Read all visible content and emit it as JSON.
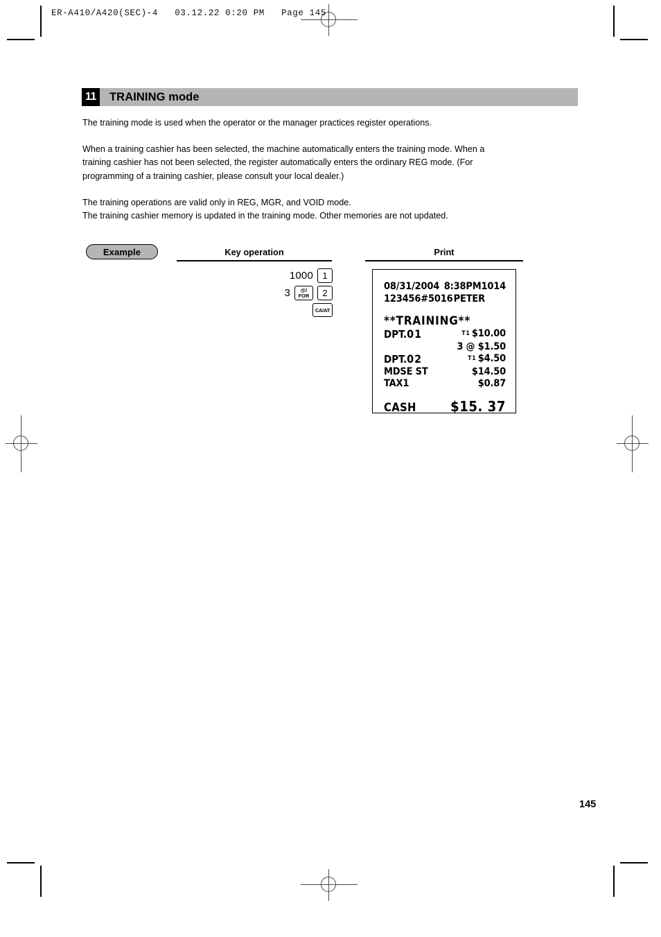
{
  "print_strip": {
    "text": "ER-A410/A420(SEC)-4   03.12.22 0:20 PM   Page 145"
  },
  "section": {
    "number": "11",
    "title": "TRAINING mode"
  },
  "paragraphs": [
    {
      "lines": [
        "The training mode is used when the operator or the manager practices register operations."
      ]
    },
    {
      "lines": [
        "When a training cashier has been selected, the machine automatically enters the training mode.  When a",
        "training cashier has not been selected, the register automatically enters the ordinary REG mode.  (For",
        "programming of a training cashier, please consult your local dealer.)"
      ]
    },
    {
      "lines": [
        "The training operations are valid only in REG, MGR, and VOID mode.",
        "The training cashier memory is updated in the training mode.  Other memories are not updated."
      ]
    }
  ],
  "example": {
    "badge_label": "Example",
    "key_operation_header": "Key operation",
    "print_header": "Print"
  },
  "key_operation": {
    "rows": [
      {
        "amount": "1000",
        "key": "1"
      },
      {
        "amount": "3",
        "key_for_top": "@/",
        "key_for_bottom": "FOR",
        "key": "2"
      },
      {
        "key_total": "CA/AT"
      }
    ]
  },
  "receipt": {
    "header_line1_left": "08/31/2004",
    "header_line1_mid": "8:38PM",
    "header_line1_right": "1014",
    "header_line2_left": "123456#5016",
    "header_line2_right": "PETER",
    "training_banner": "**TRAINING**",
    "lines": [
      {
        "label_prefix": "DPT.",
        "label_num": "01",
        "tax": "T1",
        "amount": "$10.00"
      },
      {
        "label_prefix": "",
        "label_num": "",
        "tax": "",
        "amount": "3 @ $1.50"
      },
      {
        "label_prefix": "DPT.",
        "label_num": "02",
        "tax": "T1",
        "amount": "$4.50"
      },
      {
        "label_prefix": "MDSE ST",
        "label_num": "",
        "tax": "",
        "amount": "$14.50"
      },
      {
        "label_prefix": "TAX1",
        "label_num": "",
        "tax": "",
        "amount": "$0.87"
      }
    ],
    "total_label": "CASH",
    "total_amount": "$15. 37"
  },
  "page_number": "145",
  "colors": {
    "section_band": "#b5b5b5",
    "section_number_bg": "#000000",
    "text": "#000000",
    "reg_mark": "#4a4a4a"
  }
}
